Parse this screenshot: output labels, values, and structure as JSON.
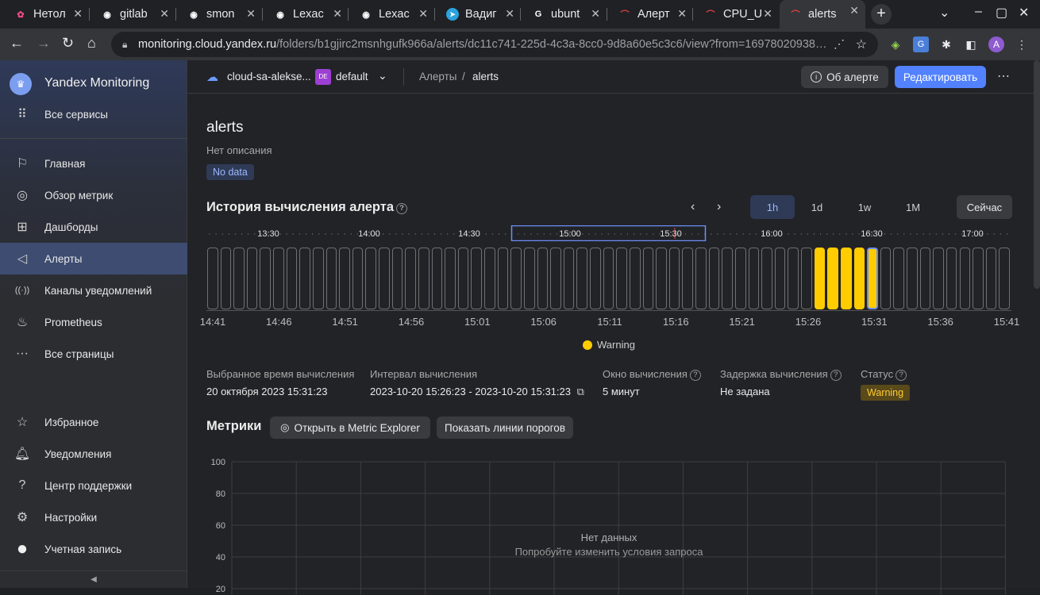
{
  "browser": {
    "tabs": [
      {
        "label": "Нетол",
        "icon": "netology-icon",
        "color": "#f04b8c"
      },
      {
        "label": "gitlab",
        "icon": "github-icon",
        "color": "#ffffff"
      },
      {
        "label": "smon",
        "icon": "github-icon",
        "color": "#ffffff"
      },
      {
        "label": "Lexac",
        "icon": "github-icon",
        "color": "#ffffff"
      },
      {
        "label": "Lexac",
        "icon": "github-icon",
        "color": "#ffffff"
      },
      {
        "label": "Вадиг",
        "icon": "telegram-icon",
        "color": "#2aa3df"
      },
      {
        "label": "ubunt",
        "icon": "google-icon",
        "color": "#ffffff"
      },
      {
        "label": "Алерт",
        "icon": "monitoring-icon",
        "color": "#e04040"
      },
      {
        "label": "CPU_U",
        "icon": "monitoring-icon",
        "color": "#e04040"
      },
      {
        "label": "alerts",
        "icon": "monitoring-icon",
        "color": "#e04040"
      }
    ],
    "url_host": "monitoring.cloud.yandex.ru",
    "url_path": "/folders/b1gjirc2msnhgufk966a/alerts/dc11c741-225d-4c3a-8cc0-9d8a60e5c3c6/view?from=16978020938…",
    "profile_initial": "A"
  },
  "sidebar": {
    "title": "Yandex Monitoring",
    "top_items": [
      {
        "label": "Все сервисы",
        "icon": "grid-icon",
        "glyph": "⠿"
      }
    ],
    "items": [
      {
        "label": "Главная",
        "icon": "flag-icon",
        "glyph": "⚐"
      },
      {
        "label": "Обзор метрик",
        "icon": "compass-icon",
        "glyph": "◎"
      },
      {
        "label": "Дашборды",
        "icon": "dashboard-icon",
        "glyph": "⊞"
      },
      {
        "label": "Алерты",
        "icon": "megaphone-icon",
        "glyph": "◁"
      },
      {
        "label": "Каналы уведомлений",
        "icon": "broadcast-icon",
        "glyph": "((·))"
      },
      {
        "label": "Prometheus",
        "icon": "flame-icon",
        "glyph": "♨"
      },
      {
        "label": "Все страницы",
        "icon": "more-icon",
        "glyph": "···"
      }
    ],
    "bottom_items": [
      {
        "label": "Избранное",
        "icon": "star-icon",
        "glyph": "☆"
      },
      {
        "label": "Уведомления",
        "icon": "bell-icon",
        "glyph": "🔔︎"
      },
      {
        "label": "Центр поддержки",
        "icon": "help-icon",
        "glyph": "?"
      },
      {
        "label": "Настройки",
        "icon": "gear-icon",
        "glyph": "⚙"
      },
      {
        "label": "Учетная запись",
        "icon": "avatar-icon",
        "glyph": "●"
      }
    ],
    "active_item": "Алерты"
  },
  "header": {
    "cloud": "cloud-sa-alekse...",
    "folder_badge": "DE",
    "folder": "default",
    "breadcrumb_parent": "Алерты",
    "breadcrumb_sep": "/",
    "breadcrumb_current": "alerts",
    "about_button": "Об алерте",
    "edit_button": "Редактировать"
  },
  "alert": {
    "title": "alerts",
    "description": "Нет описания",
    "status_chip": "No data"
  },
  "history": {
    "title": "История вычисления алерта",
    "ranges": [
      "1h",
      "1d",
      "1w",
      "1M"
    ],
    "active_range": "1h",
    "now_button": "Сейчас",
    "mini_ticks": [
      "13:30",
      "14:00",
      "14:30",
      "15:00",
      "15:30",
      "16:00",
      "16:30",
      "17:00"
    ],
    "tick_labels": [
      "14:41",
      "14:46",
      "14:51",
      "14:56",
      "15:01",
      "15:06",
      "15:11",
      "15:16",
      "15:21",
      "15:26",
      "15:31",
      "15:36",
      "15:41"
    ],
    "bar_count": 61,
    "warning_bars": [
      46,
      47,
      48,
      49
    ],
    "selected_bar": 50,
    "legend": "Warning",
    "legend_color": "#ffcc00"
  },
  "details": {
    "selected_time_label": "Выбранное время вычисления",
    "selected_time_value": "20 октября 2023 15:31:23",
    "interval_label": "Интервал вычисления",
    "interval_value": "2023-10-20 15:26:23 - 2023-10-20 15:31:23",
    "window_label": "Окно вычисления",
    "window_value": "5 минут",
    "delay_label": "Задержка вычисления",
    "delay_value": "Не задана",
    "status_label": "Статус",
    "status_value": "Warning"
  },
  "metrics": {
    "title": "Метрики",
    "open_explorer": "Открыть в Metric Explorer",
    "show_thresholds": "Показать линии порогов",
    "y_ticks": [
      "100",
      "80",
      "60",
      "40",
      "20"
    ],
    "empty_title": "Нет данных",
    "empty_hint": "Попробуйте изменить условия запроса"
  }
}
